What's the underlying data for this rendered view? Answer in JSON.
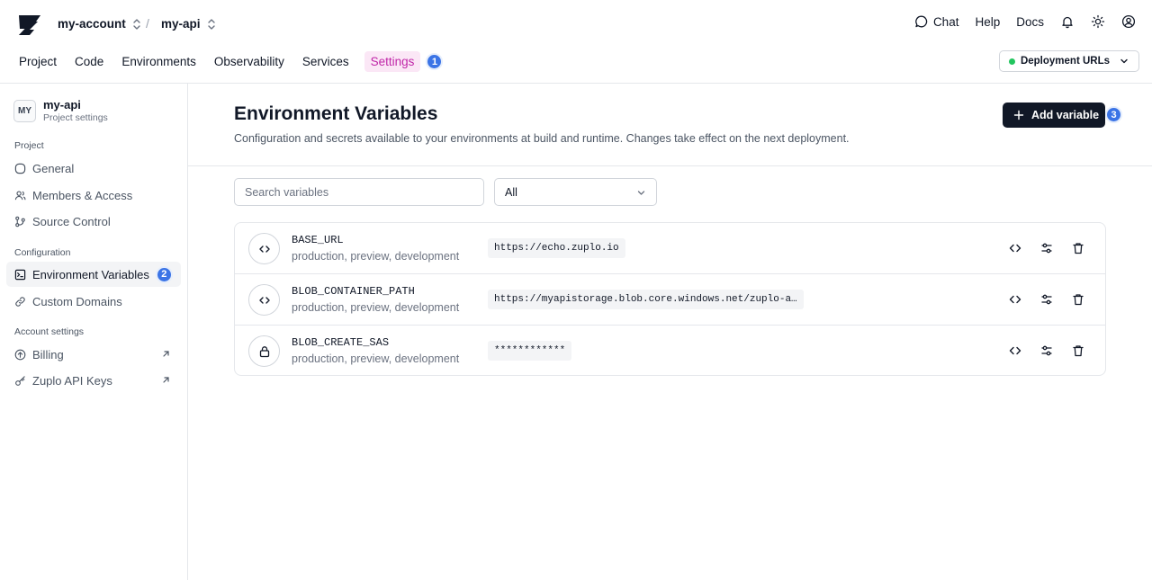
{
  "header": {
    "account": "my-account",
    "separator": "/",
    "project": "my-api",
    "links": {
      "chat": "Chat",
      "help": "Help",
      "docs": "Docs"
    },
    "tabs": [
      {
        "label": "Project"
      },
      {
        "label": "Code"
      },
      {
        "label": "Environments"
      },
      {
        "label": "Observability"
      },
      {
        "label": "Services"
      },
      {
        "label": "Settings",
        "active": true,
        "badge": "1"
      }
    ],
    "deployment_urls_label": "Deployment URLs",
    "status_color": "#22c55e",
    "accent_color": "#c026a8"
  },
  "sidebar": {
    "avatar": "MY",
    "project_name": "my-api",
    "project_subtitle": "Project settings",
    "sections": {
      "project": "Project",
      "configuration": "Configuration",
      "account": "Account settings"
    },
    "items": [
      {
        "label": "General",
        "icon": "circle-icon"
      },
      {
        "label": "Members & Access",
        "icon": "users-icon"
      },
      {
        "label": "Source Control",
        "icon": "git-branch-icon"
      },
      {
        "label": "Environment Variables",
        "icon": "terminal-square-icon",
        "active": true,
        "badge": "2"
      },
      {
        "label": "Custom Domains",
        "icon": "link-icon"
      },
      {
        "label": "Billing",
        "icon": "arrow-up-circle-icon",
        "external": true
      },
      {
        "label": "Zuplo API Keys",
        "icon": "key-icon",
        "external": true
      }
    ]
  },
  "main": {
    "title": "Environment Variables",
    "description": "Configuration and secrets available to your environments at build and runtime. Changes take effect on the next deployment.",
    "add_button": "Add variable",
    "add_badge": "3",
    "search_placeholder": "Search variables",
    "filter_value": "All",
    "variables": [
      {
        "name": "BASE_URL",
        "envs": "production, preview, development",
        "value": "https://echo.zuplo.io",
        "icon": "code-icon"
      },
      {
        "name": "BLOB_CONTAINER_PATH",
        "envs": "production, preview, development",
        "value": "https://myapistorage.blob.core.windows.net/zuplo-a…",
        "icon": "code-icon"
      },
      {
        "name": "BLOB_CREATE_SAS",
        "envs": "production, preview, development",
        "value": "************",
        "icon": "lock-icon"
      }
    ]
  }
}
